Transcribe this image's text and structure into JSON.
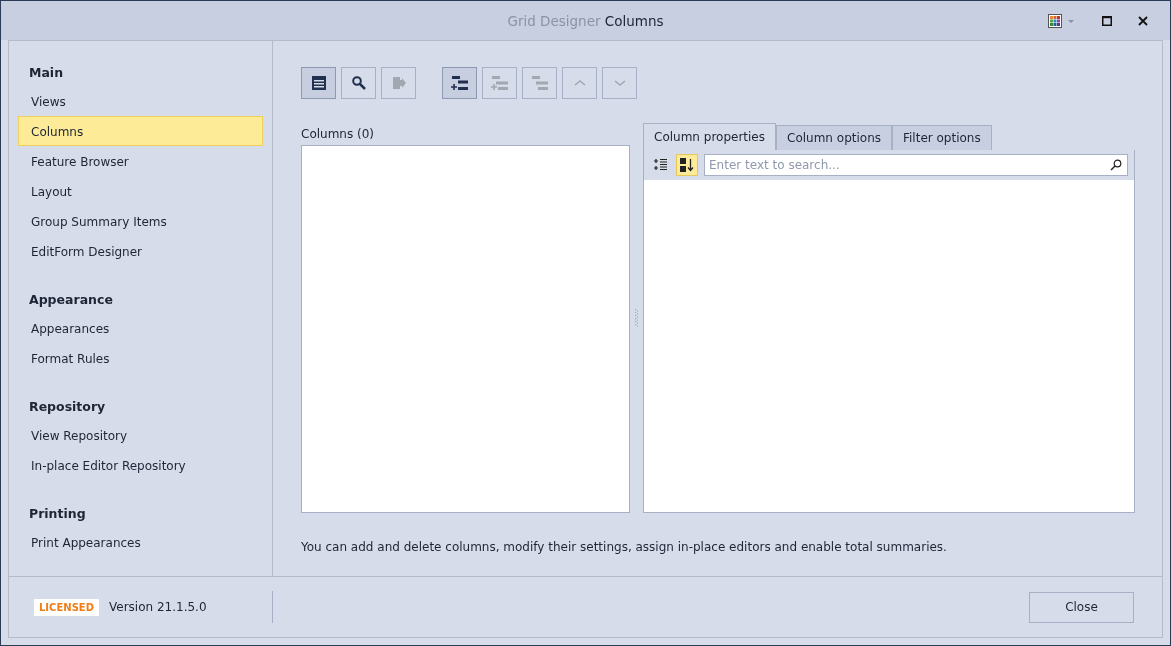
{
  "window": {
    "title_prefix": "Grid Designer",
    "title": "Columns"
  },
  "sidebar": {
    "groups": [
      {
        "title": "Main",
        "items": [
          {
            "label": "Views",
            "selected": false
          },
          {
            "label": "Columns",
            "selected": true
          },
          {
            "label": "Feature Browser",
            "selected": false
          },
          {
            "label": "Layout",
            "selected": false
          },
          {
            "label": "Group Summary Items",
            "selected": false
          },
          {
            "label": "EditForm Designer",
            "selected": false
          }
        ]
      },
      {
        "title": "Appearance",
        "items": [
          {
            "label": "Appearances",
            "selected": false
          },
          {
            "label": "Format Rules",
            "selected": false
          }
        ]
      },
      {
        "title": "Repository",
        "items": [
          {
            "label": "View Repository",
            "selected": false
          },
          {
            "label": "In-place Editor Repository",
            "selected": false
          }
        ]
      },
      {
        "title": "Printing",
        "items": [
          {
            "label": "Print Appearances",
            "selected": false
          }
        ]
      }
    ]
  },
  "toolbar_groups": [
    [
      {
        "kind": "form",
        "pressed": true,
        "disabled": false
      },
      {
        "kind": "search",
        "pressed": false,
        "disabled": false
      },
      {
        "kind": "retrieve",
        "pressed": false,
        "disabled": true
      }
    ],
    [
      {
        "kind": "add",
        "pressed": true,
        "disabled": false
      },
      {
        "kind": "insert",
        "pressed": false,
        "disabled": true
      },
      {
        "kind": "remove",
        "pressed": false,
        "disabled": true
      },
      {
        "kind": "up",
        "pressed": false,
        "disabled": true
      },
      {
        "kind": "down",
        "pressed": false,
        "disabled": true
      }
    ]
  ],
  "columns_list": {
    "label": "Columns (0)"
  },
  "tabs": [
    {
      "label": "Column properties",
      "selected": true
    },
    {
      "label": "Column options",
      "selected": false
    },
    {
      "label": "Filter options",
      "selected": false
    }
  ],
  "property_grid": {
    "sort_buttons": [
      {
        "kind": "categorized",
        "selected": false
      },
      {
        "kind": "alphabetical",
        "selected": true
      }
    ],
    "search": {
      "placeholder": "Enter text to search..."
    }
  },
  "hint": "You can add and delete columns, modify their settings, assign in-place editors and enable total summaries.",
  "footer": {
    "badge": "LICENSED",
    "version": "Version 21.1.5.0",
    "close_button": "Close"
  }
}
